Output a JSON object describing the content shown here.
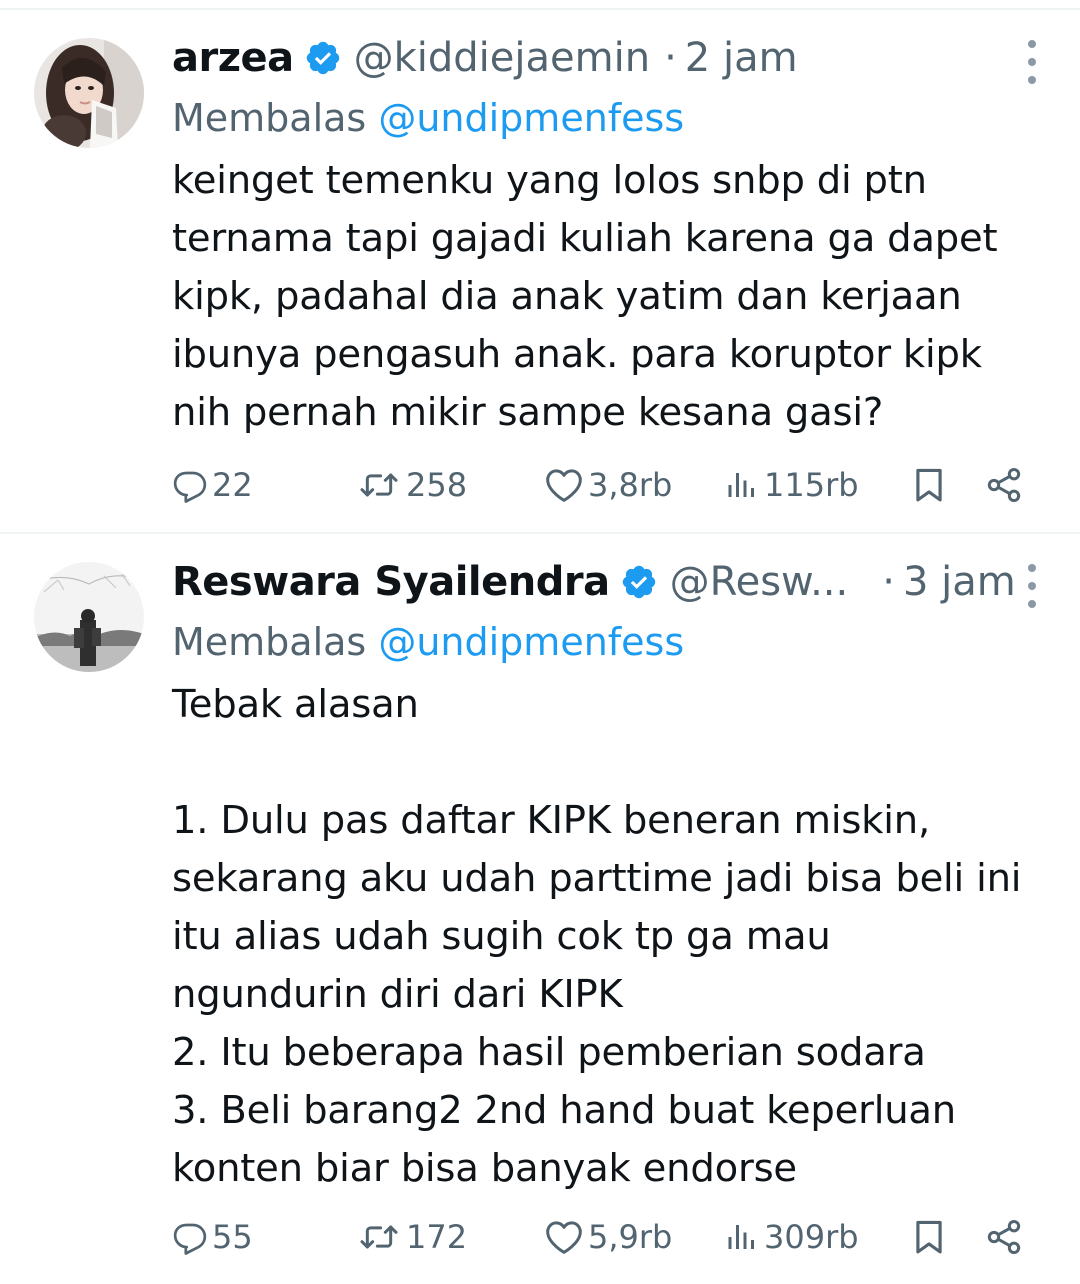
{
  "tweets": [
    {
      "name": "arzea",
      "handle": "@kiddiejaemin",
      "dot": "·",
      "time": "2 jam",
      "reply_prefix": "Membalas",
      "reply_to": "@undipmenfess",
      "text": "keinget temenku yang lolos snbp di ptn\nternama tapi gajadi kuliah karena ga dapet\nkipk, padahal dia anak yatim dan kerjaan\nibunya pengasuh anak. para koruptor kipk\nnih pernah mikir sampe kesana gasi?",
      "replies": "22",
      "reposts": "258",
      "likes": "3,8rb",
      "views": "115rb"
    },
    {
      "name": "Reswara Syailendra",
      "handle": "@Resw...",
      "dot": "·",
      "time": "3 jam",
      "reply_prefix": "Membalas",
      "reply_to": "@undipmenfess",
      "text": "Tebak alasan\n\n1. Dulu pas daftar KIPK beneran miskin,\nsekarang aku udah parttime jadi bisa beli ini\nitu alias udah sugih cok tp ga mau\nngundurin diri dari KIPK\n2. Itu beberapa hasil pemberian sodara\n3. Beli barang2 2nd hand buat keperluan\nkonten biar bisa banyak endorse",
      "replies": "55",
      "reposts": "172",
      "likes": "5,9rb",
      "views": "309rb"
    }
  ],
  "colors": {
    "text": "#0f1419",
    "secondary": "#536471",
    "accent": "#1d9bf0",
    "divider": "#eff3f4"
  },
  "icons": [
    "verified-badge-icon",
    "more-icon",
    "reply-icon",
    "repost-icon",
    "like-icon",
    "views-icon",
    "bookmark-icon",
    "share-icon"
  ]
}
